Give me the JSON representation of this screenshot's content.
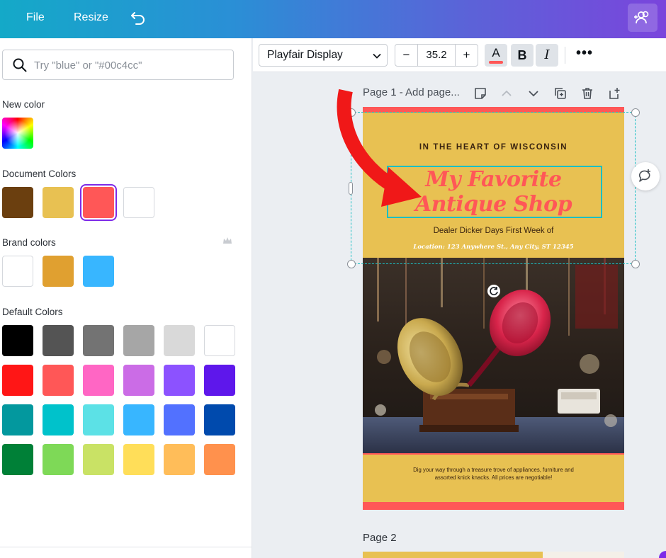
{
  "topbar": {
    "file_label": "File",
    "resize_label": "Resize",
    "gradient_start": "#14a9c8",
    "gradient_end": "#7a45dc"
  },
  "panel": {
    "search_placeholder": "Try \"blue\" or \"#00c4cc\"",
    "new_color_title": "New color",
    "document_colors_title": "Document Colors",
    "document_colors": [
      "#6b3f0f",
      "#e8c152",
      "#ff5757",
      "#ffffff"
    ],
    "document_selected_index": 2,
    "brand_colors_title": "Brand colors",
    "brand_colors": [
      "#ffffff",
      "#e0a030",
      "#38b6ff"
    ],
    "default_colors_title": "Default Colors",
    "default_colors": [
      [
        "#000000",
        "#545454",
        "#737373",
        "#a6a6a6",
        "#d9d9d9",
        "#ffffff"
      ],
      [
        "#ff1616",
        "#ff5757",
        "#ff66c4",
        "#cb6ce6",
        "#8c52ff",
        "#5e17eb"
      ],
      [
        "#03989e",
        "#00c2cb",
        "#5ce1e6",
        "#38b6ff",
        "#5271ff",
        "#004aad"
      ],
      [
        "#008037",
        "#7ed957",
        "#c9e265",
        "#ffde59",
        "#ffbd59",
        "#ff914d"
      ]
    ]
  },
  "toolbar": {
    "font_name": "Playfair Display",
    "font_size": "35.2",
    "minus": "−",
    "plus": "+",
    "color_label": "A",
    "bold_label": "B",
    "italic_label": "I",
    "more_label": "•••",
    "text_color": "#ff5757"
  },
  "canvas": {
    "page1_label": "Page 1 - Add page...",
    "page2_label": "Page 2"
  },
  "design": {
    "tagline": "IN THE HEART OF WISCONSIN",
    "title_line1": "My Favorite",
    "title_line2": "Antique Shop",
    "dealer_line": "Dealer Dicker Days First Week of",
    "location": "Location: 123 Anywhere St., Any City, ST 12345",
    "description_line1": "Dig your way through a treasure trove of appliances, furniture and",
    "description_line2": "assorted knick knacks. All prices are negotiable!",
    "background": "#e8c152",
    "accent": "#ff5757"
  }
}
